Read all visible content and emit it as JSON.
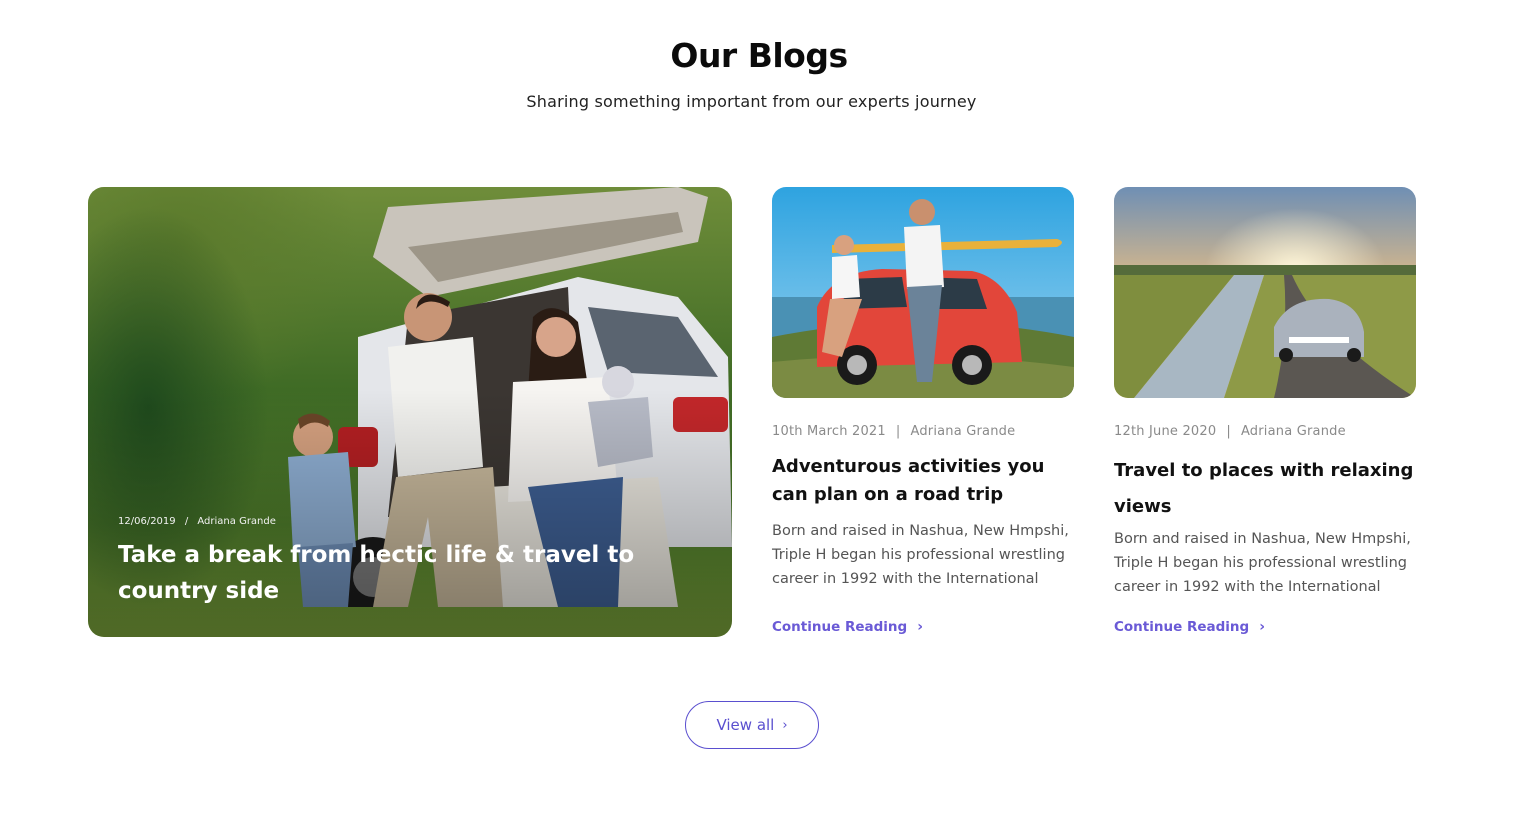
{
  "section": {
    "title": "Our Blogs",
    "subtitle": "Sharing something important from our experts journey"
  },
  "featured_post": {
    "date": "12/06/2019",
    "separator": "/",
    "author": "Adriana Grande",
    "title": "Take a break from hectic life & travel to country side"
  },
  "posts": [
    {
      "date": "10th March 2021",
      "separator": "|",
      "author": "Adriana Grande",
      "title": "Adventurous activities you can plan on a road trip",
      "excerpt": "Born and raised in Nashua, New Hmpshi, Triple H began his professional wrestling career in 1992 with the International",
      "link_label": "Continue Reading"
    },
    {
      "date": "12th June 2020",
      "separator": "|",
      "author": "Adriana Grande",
      "title": "Travel to places with relaxing views",
      "excerpt": "Born and raised in Nashua, New Hmpshi, Triple H began his professional wrestling career in 1992 with the International",
      "link_label": "Continue Reading"
    }
  ],
  "view_all_label": "View all",
  "icons": {
    "chevron": "chevron-right-icon"
  },
  "colors": {
    "accent": "#6a5ad6",
    "heading": "#111111",
    "meta": "#8a8a8a",
    "body": "#555555"
  }
}
